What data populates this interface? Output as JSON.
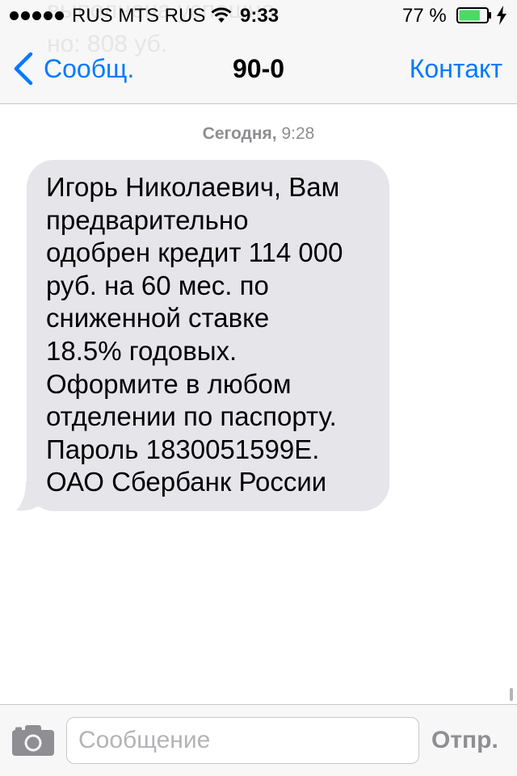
{
  "status_bar": {
    "carrier": "RUS MTS RUS",
    "time": "9:33",
    "battery_percent": "77 %",
    "signal_icon": "signal-dots-icon",
    "wifi_icon": "wifi-icon",
    "battery_icon": "battery-icon",
    "battery_level": 0.77,
    "charging_icon": "charging-bolt-icon"
  },
  "background_preview_lines": [
    "выполнена успешно.",
    "но: 808 уб."
  ],
  "nav": {
    "back_label": "Сообщ.",
    "title": "90-0",
    "contact_label": "Контакт"
  },
  "conversation": {
    "timestamp_day": "Сегодня,",
    "timestamp_time": "9:28",
    "message_lines": [
      "Игорь Николаевич, Вам",
      "предварительно",
      "одобрен кредит 114 000",
      "руб. на 60 мес. по",
      "сниженной ставке",
      "18.5% годовых.",
      "Оформите в любом",
      "отделении по паспорту.",
      "Пароль 1830051599E.",
      "ОАО Сбербанк России"
    ]
  },
  "input_bar": {
    "camera_icon": "camera-icon",
    "placeholder": "Сообщение",
    "send_label": "Отпр."
  },
  "colors": {
    "accent": "#007aff",
    "bar_background": "#f7f7f8",
    "bubble_gray": "#e5e5ea",
    "battery_green": "#4cd964",
    "timestamp_gray": "#8e8e93"
  }
}
